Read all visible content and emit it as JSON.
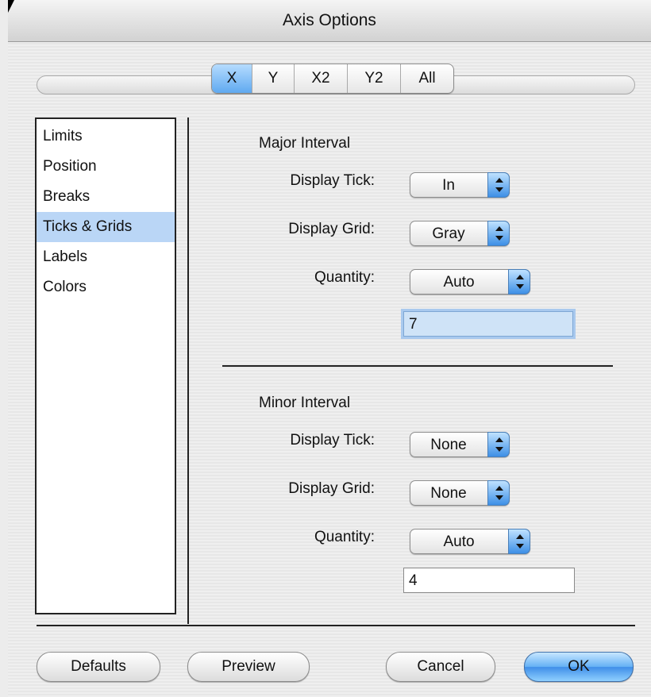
{
  "window": {
    "title": "Axis Options"
  },
  "axis_tabs": [
    {
      "label": "X",
      "active": true
    },
    {
      "label": "Y",
      "active": false
    },
    {
      "label": "X2",
      "active": false
    },
    {
      "label": "Y2",
      "active": false
    },
    {
      "label": "All",
      "active": false
    }
  ],
  "sidebar": {
    "items": [
      {
        "label": "Limits"
      },
      {
        "label": "Position"
      },
      {
        "label": "Breaks"
      },
      {
        "label": "Ticks & Grids",
        "selected": true
      },
      {
        "label": "Labels"
      },
      {
        "label": "Colors"
      }
    ]
  },
  "major": {
    "title": "Major Interval",
    "tick_label": "Display Tick:",
    "tick_value": "In",
    "grid_label": "Display Grid:",
    "grid_value": "Gray",
    "quantity_label": "Quantity:",
    "quantity_value": "Auto",
    "count_value": "7"
  },
  "minor": {
    "title": "Minor Interval",
    "tick_label": "Display Tick:",
    "tick_value": "None",
    "grid_label": "Display Grid:",
    "grid_value": "None",
    "quantity_label": "Quantity:",
    "quantity_value": "Auto",
    "count_value": "4"
  },
  "buttons": {
    "defaults": "Defaults",
    "preview": "Preview",
    "cancel": "Cancel",
    "ok": "OK"
  },
  "colors": {
    "accent": "#5fa9f0",
    "selection": "#bad6f6"
  }
}
